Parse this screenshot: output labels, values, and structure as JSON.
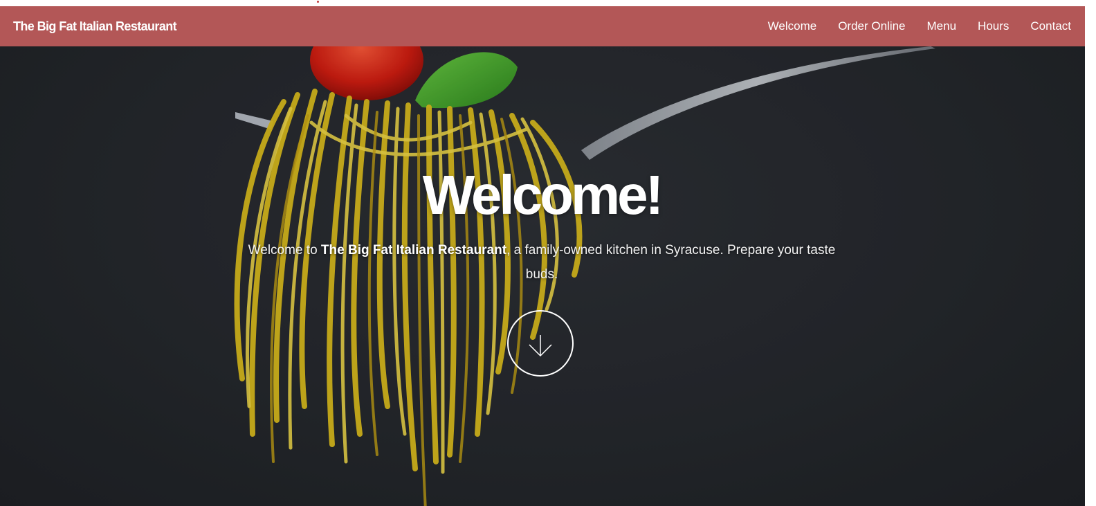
{
  "navbar": {
    "brand": "The Big Fat Italian Restaurant",
    "links": [
      {
        "label": "Welcome"
      },
      {
        "label": "Order Online"
      },
      {
        "label": "Menu"
      },
      {
        "label": "Hours"
      },
      {
        "label": "Contact"
      }
    ]
  },
  "hero": {
    "title": "Welcome!",
    "intro_before": "Welcome to ",
    "intro_bold": "The Big Fat Italian Restaurant",
    "intro_after": ", a family-owned kitchen in Syracuse. Prepare your taste buds.",
    "scroll_icon": "arrow-down-icon",
    "background_image": "pasta-on-fork-photo"
  },
  "colors": {
    "navbar": "#b35757",
    "hero_background": "#26292e",
    "text": "#ffffff"
  }
}
